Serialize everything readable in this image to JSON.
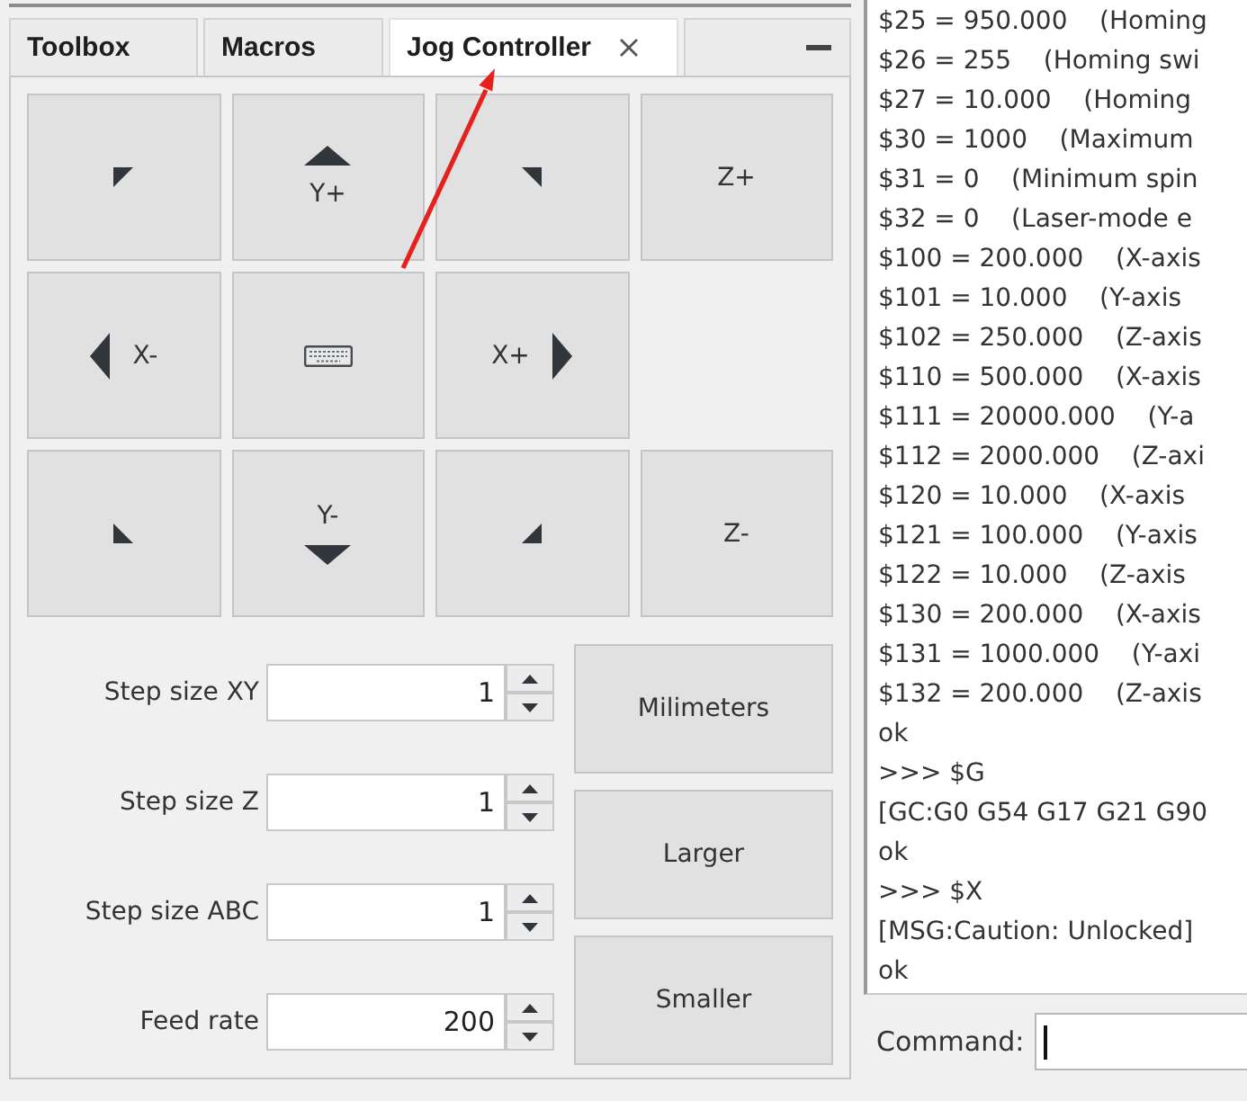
{
  "tabs": [
    {
      "label": "Toolbox",
      "selected": false,
      "closable": false
    },
    {
      "label": "Macros",
      "selected": false,
      "closable": false
    },
    {
      "label": "Jog Controller",
      "selected": true,
      "closable": true
    }
  ],
  "jog_pad": {
    "buttons": [
      {
        "kind": "corner-nw"
      },
      {
        "kind": "arrow-up",
        "label": "Y+"
      },
      {
        "kind": "corner-ne"
      },
      {
        "kind": "label",
        "label": "Z+"
      },
      {
        "kind": "arrow-left",
        "label": "X-"
      },
      {
        "kind": "keyboard"
      },
      {
        "kind": "arrow-right",
        "label": "X+"
      },
      {
        "kind": "spacer"
      },
      {
        "kind": "corner-sw"
      },
      {
        "kind": "arrow-down",
        "label": "Y-"
      },
      {
        "kind": "corner-se"
      },
      {
        "kind": "label",
        "label": "Z-"
      }
    ]
  },
  "step_settings": {
    "fields": [
      {
        "label": "Step size XY",
        "value": "1"
      },
      {
        "label": "Step size Z",
        "value": "1"
      },
      {
        "label": "Step size ABC",
        "value": "1"
      },
      {
        "label": "Feed rate",
        "value": "200"
      }
    ],
    "buttons": [
      "Milimeters",
      "Larger",
      "Smaller"
    ]
  },
  "console": {
    "lines": [
      "$25 = 950.000    (Homing",
      "$26 = 255    (Homing swi",
      "$27 = 10.000    (Homing",
      "$30 = 1000    (Maximum",
      "$31 = 0    (Minimum spin",
      "$32 = 0    (Laser-mode e",
      "$100 = 200.000    (X-axis",
      "$101 = 10.000    (Y-axis",
      "$102 = 250.000    (Z-axis",
      "$110 = 500.000    (X-axis",
      "$111 = 20000.000    (Y-a",
      "$112 = 2000.000    (Z-axi",
      "$120 = 10.000    (X-axis",
      "$121 = 100.000    (Y-axis",
      "$122 = 10.000    (Z-axis",
      "$130 = 200.000    (X-axis",
      "$131 = 1000.000    (Y-axi",
      "$132 = 200.000    (Z-axis",
      "ok",
      ">>> $G",
      "[GC:G0 G54 G17 G21 G90",
      "ok",
      ">>> $X",
      "[MSG:Caution: Unlocked]",
      "ok"
    ]
  },
  "command": {
    "label": "Command:",
    "focused": true
  }
}
